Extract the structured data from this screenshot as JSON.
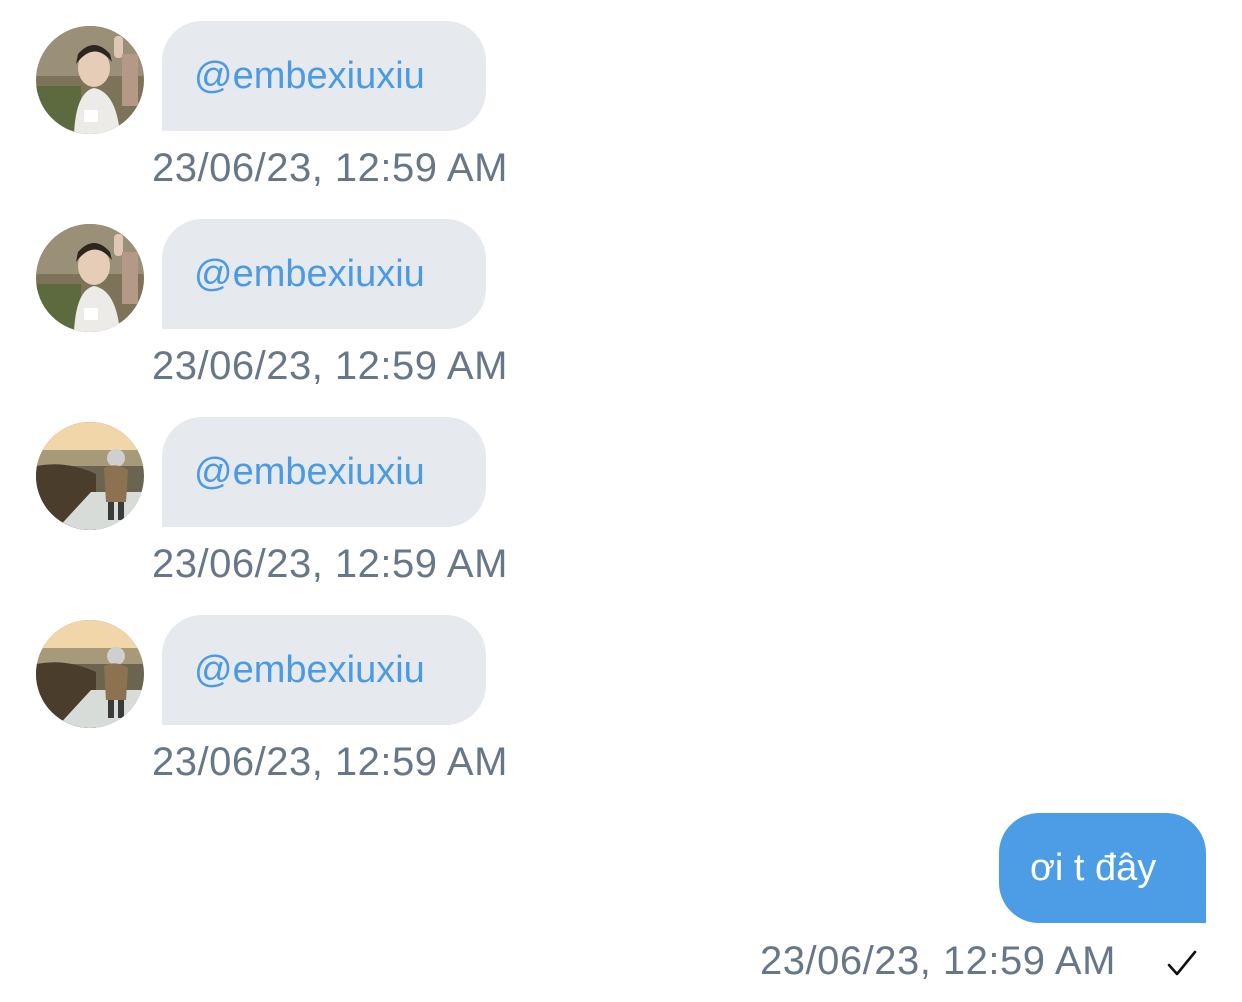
{
  "messages": [
    {
      "mention": "@embexiuxiu",
      "timestamp": "23/06/23, 12:59 AM",
      "avatar": "person-portrait-avatar"
    },
    {
      "mention": "@embexiuxiu",
      "timestamp": "23/06/23, 12:59 AM",
      "avatar": "person-portrait-avatar"
    },
    {
      "mention": "@embexiuxiu",
      "timestamp": "23/06/23, 12:59 AM",
      "avatar": "landscape-figure-avatar"
    },
    {
      "mention": "@embexiuxiu",
      "timestamp": "23/06/23, 12:59 AM",
      "avatar": "landscape-figure-avatar"
    }
  ],
  "outgoing": {
    "text": "ơi t đây",
    "timestamp": "23/06/23, 12:59 AM",
    "status_icon": "checkmark-icon"
  },
  "colors": {
    "incoming_bubble": "#e6e9ee",
    "outgoing_bubble": "#4c9de6",
    "mention_link": "#4a9be3",
    "timestamp": "#687787"
  }
}
